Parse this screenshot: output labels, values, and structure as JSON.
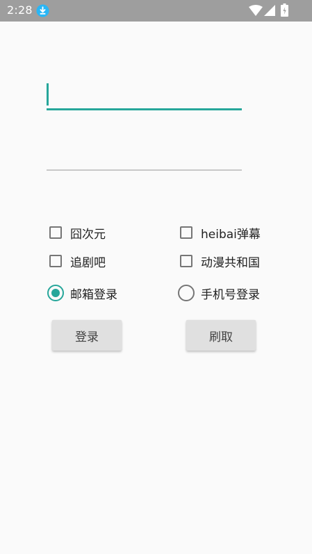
{
  "status_bar": {
    "time": "2:28",
    "icons": [
      "download-icon",
      "wifi-icon",
      "signal-icon",
      "battery-icon"
    ],
    "background": "#9e9e9e"
  },
  "form": {
    "accent_color": "#26a69a",
    "fields": [
      {
        "value": "",
        "focused": true
      },
      {
        "value": "",
        "focused": false
      }
    ],
    "checkboxes": [
      {
        "label": "囧次元",
        "checked": false
      },
      {
        "label": "heibai弹幕",
        "checked": false
      },
      {
        "label": "追剧吧",
        "checked": false
      },
      {
        "label": "动漫共和国",
        "checked": false
      }
    ],
    "radios": [
      {
        "label": "邮箱登录",
        "checked": true
      },
      {
        "label": "手机号登录",
        "checked": false
      }
    ],
    "buttons": {
      "login": "登录",
      "fetch": "刷取"
    }
  }
}
